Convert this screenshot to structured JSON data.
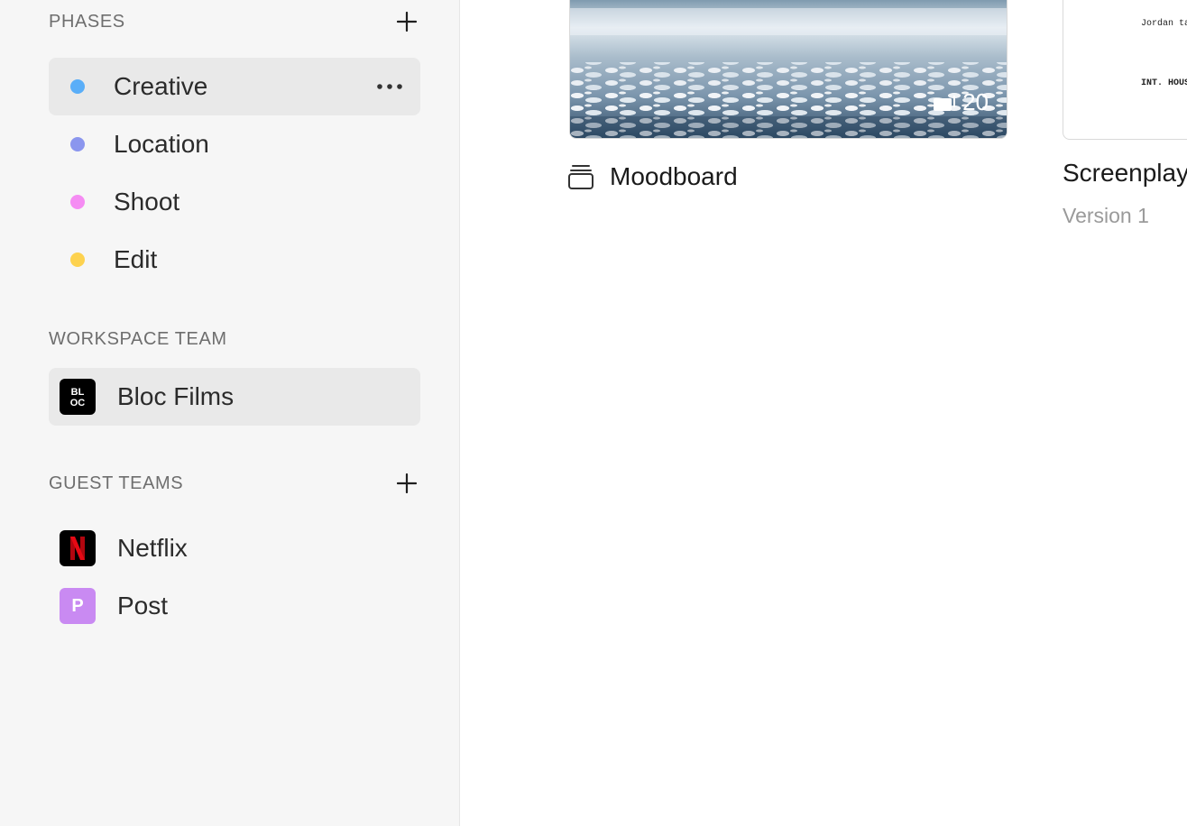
{
  "sidebar": {
    "phases": {
      "title": "PHASES",
      "items": [
        {
          "label": "Creative",
          "color": "#5aaef8",
          "selected": true
        },
        {
          "label": "Location",
          "color": "#8b96ee",
          "selected": false
        },
        {
          "label": "Shoot",
          "color": "#f58cf3",
          "selected": false
        },
        {
          "label": "Edit",
          "color": "#fdd24f",
          "selected": false
        }
      ]
    },
    "workspace_team": {
      "title": "WORKSPACE TEAM",
      "items": [
        {
          "label": "Bloc Films",
          "logo_text": "BL OC",
          "logo_color": "#000000",
          "selected": true
        }
      ]
    },
    "guest_teams": {
      "title": "GUEST TEAMS",
      "items": [
        {
          "label": "Netflix",
          "logo_text": "N",
          "logo_color": "#000000",
          "logo_accent": "#e50914"
        },
        {
          "label": "Post",
          "logo_text": "P",
          "logo_color": "#c98af2"
        }
      ]
    }
  },
  "main": {
    "cards": [
      {
        "title": "Moodboard",
        "count": "20",
        "icon": "stack-icon"
      },
      {
        "title": "Screenplay",
        "subtitle": "Version 1",
        "doc_lines": [
          "Jordan tal",
          "INT. HOUS"
        ]
      }
    ]
  }
}
